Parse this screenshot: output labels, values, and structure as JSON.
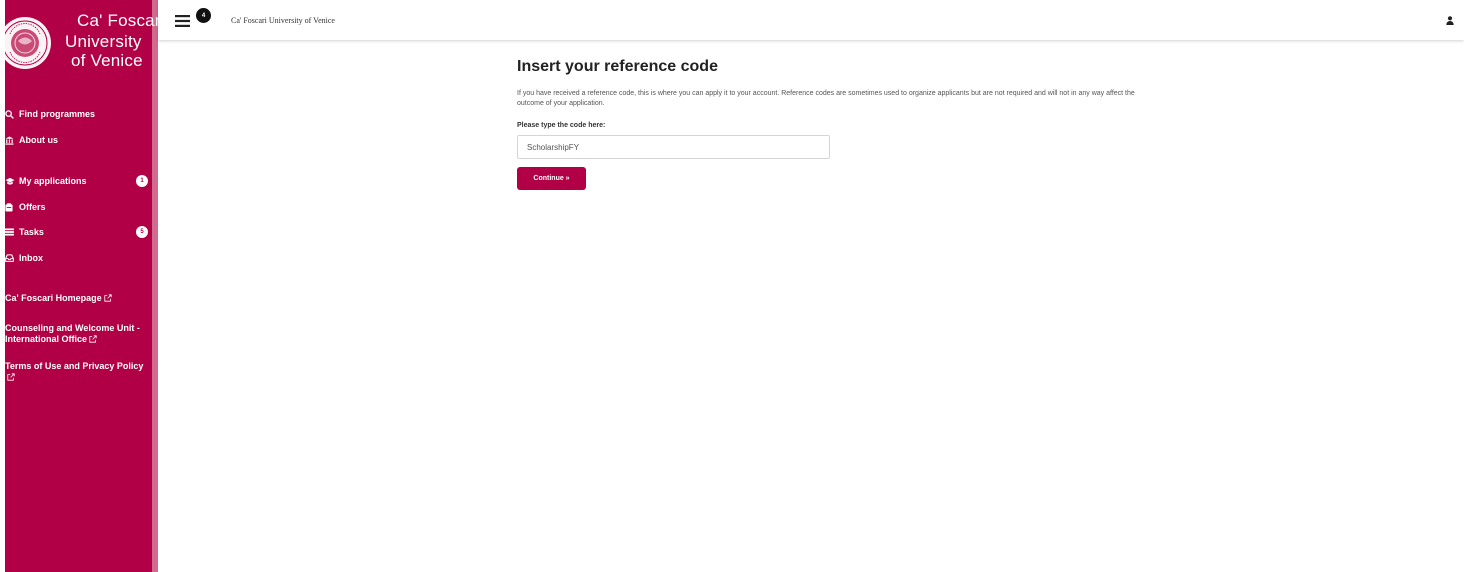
{
  "brand": {
    "line1": "Ca' Foscari",
    "line2": "University",
    "line3": "of Venice",
    "seal_icon": "university-seal-icon"
  },
  "sidebar": {
    "items": [
      {
        "label": "Find programmes",
        "icon": "search-icon"
      },
      {
        "label": "About us",
        "icon": "institution-icon"
      },
      {
        "label": "My applications",
        "icon": "graduation-cap-icon",
        "badge": "1"
      },
      {
        "label": "Offers",
        "icon": "offer-icon"
      },
      {
        "label": "Tasks",
        "icon": "list-icon",
        "badge": "5"
      },
      {
        "label": "Inbox",
        "icon": "inbox-icon"
      }
    ],
    "links": [
      {
        "label": "Ca' Foscari Homepage",
        "icon": "external-link-icon"
      },
      {
        "label": "Counseling and Welcome Unit - International Office",
        "icon": "external-link-icon"
      },
      {
        "label": "Terms of Use and Privacy Policy",
        "icon": "external-link-icon"
      }
    ]
  },
  "topbar": {
    "menu_icon": "hamburger-icon",
    "notification_count": "4",
    "title": "Ca' Foscari University of Venice",
    "user_icon": "user-icon"
  },
  "main": {
    "title": "Insert your reference code",
    "description": "If you have received a reference code, this is where you can apply it to your account. Reference codes are sometimes used to organize applicants but are not required and will not in any way affect the outcome of your application.",
    "field_label": "Please type the code here:",
    "code_value": "ScholarshipFY",
    "continue_label": "Continue »"
  },
  "colors": {
    "brand": "#b10045",
    "sidebar_edge": "#d06b8d",
    "white": "#ffffff"
  }
}
